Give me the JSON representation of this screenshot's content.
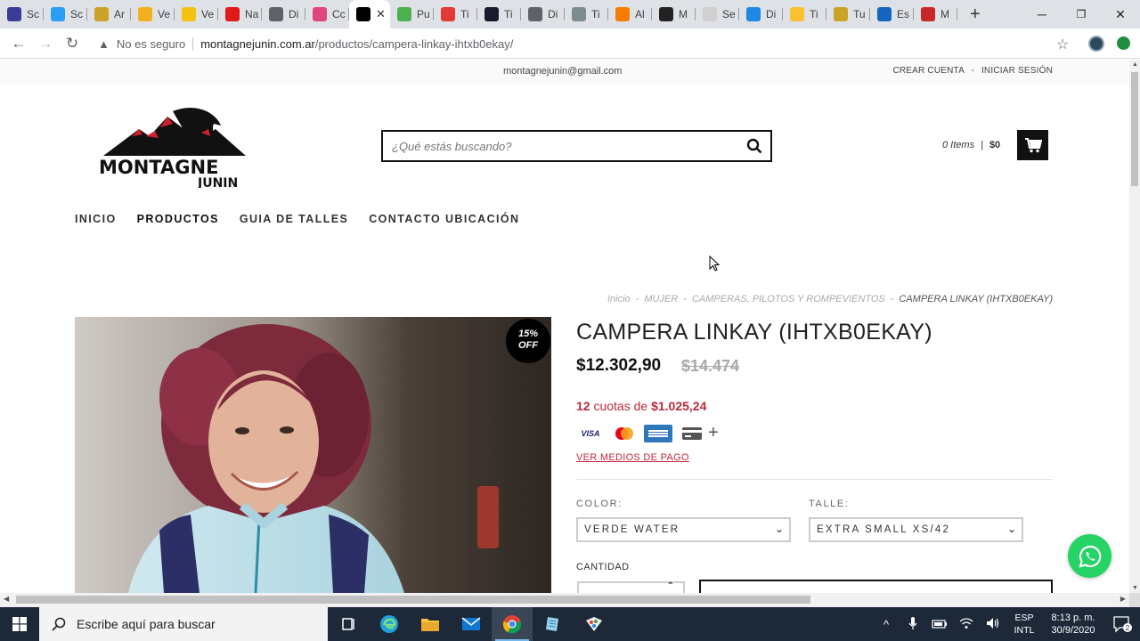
{
  "browser": {
    "tabs": [
      {
        "label": "Sc",
        "icon": "circle-icon",
        "color": "#3b3b98"
      },
      {
        "label": "Sc",
        "icon": "bird-icon",
        "color": "#2a9df4"
      },
      {
        "label": "Ar",
        "icon": "puzzle-icon",
        "color": "#c9a227"
      },
      {
        "label": "Ve",
        "icon": "smiley-icon",
        "color": "#f2b01e"
      },
      {
        "label": "Ve",
        "icon": "chrome-icon",
        "color": "#f4c20d"
      },
      {
        "label": "Na",
        "icon": "flag-icon",
        "color": "#e01919"
      },
      {
        "label": "Di",
        "icon": "link-icon",
        "color": "#5f6368"
      },
      {
        "label": "Cc",
        "icon": "canva-icon",
        "color": "#e0457b"
      },
      {
        "label": "",
        "icon": "mountain-icon",
        "color": "#000000",
        "active": true
      },
      {
        "label": "Pu",
        "icon": "palette-icon",
        "color": "#4caf50"
      },
      {
        "label": "Ti",
        "icon": "arrow-circle-icon",
        "color": "#e53935"
      },
      {
        "label": "Ti",
        "icon": "dots-icon",
        "color": "#1a1a2e"
      },
      {
        "label": "Di",
        "icon": "link-icon",
        "color": "#5f6368"
      },
      {
        "label": "Ti",
        "icon": "grid-icon",
        "color": "#7f8c8d"
      },
      {
        "label": "Al",
        "icon": "warning-icon",
        "color": "#f57c00"
      },
      {
        "label": "M",
        "icon": "m-icon",
        "color": "#222222"
      },
      {
        "label": "Se",
        "icon": "doc-icon",
        "color": "#d0d0d0"
      },
      {
        "label": "Di",
        "icon": "cloud-icon",
        "color": "#1e88e5"
      },
      {
        "label": "Ti",
        "icon": "star-burst-icon",
        "color": "#fbc02d"
      },
      {
        "label": "Tu",
        "icon": "puzzle-icon",
        "color": "#c9a227"
      },
      {
        "label": "Es",
        "icon": "shield-icon",
        "color": "#1565c0"
      },
      {
        "label": "M",
        "icon": "mountain-icon",
        "color": "#c62828"
      }
    ],
    "active_tab_close": "✕",
    "new_tab": "+",
    "window_controls": {
      "minimize": "─",
      "restore": "❐",
      "close": "✕"
    },
    "address": {
      "security_label": "No es seguro",
      "domain": "montagnejunin.com.ar",
      "path": "/productos/campera-linkay-ihtxb0ekay/"
    }
  },
  "site": {
    "topbar": {
      "email": "montagnejunin@gmail.com",
      "create_account": "CREAR CUENTA",
      "separator": "-",
      "login": "INICIAR SESIÓN"
    },
    "logo": {
      "line1": "MONTAGNE",
      "line2": "JUNIN"
    },
    "search": {
      "placeholder": "¿Qué estás buscando?"
    },
    "cart": {
      "items": "0 Items",
      "separator": "|",
      "total": "$0"
    },
    "nav": [
      "INICIO",
      "PRODUCTOS",
      "GUIA DE TALLES",
      "CONTACTO UBICACIÓN"
    ],
    "breadcrumb": [
      "Inicio",
      "MUJER",
      "CAMPERAS, PILOTOS Y ROMPEVIENTOS",
      "CAMPERA LINKAY (IHTXB0EKAY)"
    ],
    "breadcrumb_sep": "-",
    "product": {
      "discount_line1": "15%",
      "discount_line2": "OFF",
      "title": "CAMPERA LINKAY (IHTXB0EKAY)",
      "price": "$12.302,90",
      "old_price": "$14.474",
      "installments_count": "12",
      "installments_text": " cuotas de ",
      "installment_amount": "$1.025,24",
      "payment_methods": [
        "VISA",
        "Mastercard",
        "American Express",
        "Tarjeta",
        "+"
      ],
      "payment_link": "VER MEDIOS DE PAGO",
      "color_label": "COLOR:",
      "color_value": "VERDE WATER",
      "size_label": "TALLE:",
      "size_value": "EXTRA SMALL XS/42",
      "quantity_label": "CANTIDAD"
    }
  },
  "taskbar": {
    "search_text": "Escribe aquí para buscar",
    "lang_line1": "ESP",
    "lang_line2": "INTL",
    "time": "8:13 p. m.",
    "date": "30/9/2020",
    "notifications": "2"
  },
  "colors": {
    "accent_red": "#c0283a",
    "whatsapp_green": "#25d366"
  }
}
